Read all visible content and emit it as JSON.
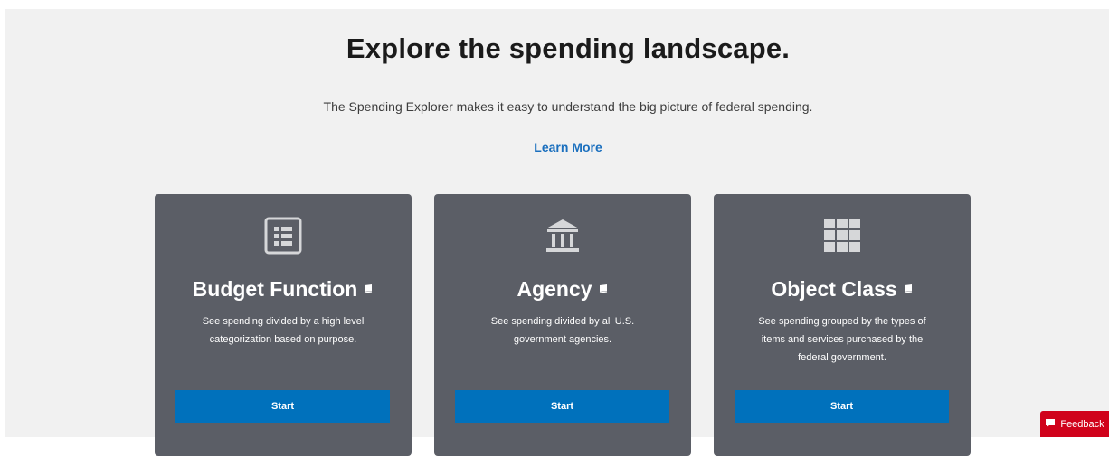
{
  "header": {
    "title": "Explore the spending landscape.",
    "subtitle": "The Spending Explorer makes it easy to understand the big picture of federal spending.",
    "learn_more": "Learn More"
  },
  "cards": [
    {
      "title": "Budget Function",
      "icon": "list-icon",
      "description": "See spending divided by a high level categorization based on purpose.",
      "button": "Start"
    },
    {
      "title": "Agency",
      "icon": "bank-icon",
      "description": "See spending divided by all U.S. government agencies.",
      "button": "Start"
    },
    {
      "title": "Object Class",
      "icon": "grid-icon",
      "description": "See spending grouped by the types of items and services purchased by the federal government.",
      "button": "Start"
    }
  ],
  "feedback": {
    "label": "Feedback",
    "icon": "chat-icon"
  },
  "colors": {
    "background": "#f1f1f1",
    "card": "#5b5e66",
    "button": "#0071bc",
    "link": "#1a6fbe",
    "feedback": "#d0021b"
  }
}
